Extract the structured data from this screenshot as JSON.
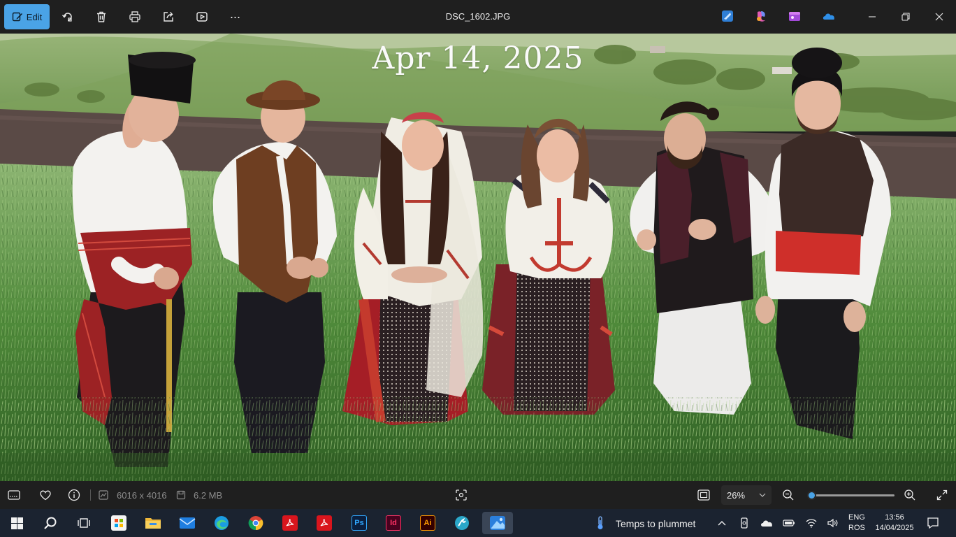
{
  "toolbar": {
    "edit_label": "Edit",
    "buttons": [
      "rotate-icon",
      "delete-icon",
      "print-icon",
      "share-icon",
      "slideshow-icon",
      "more-icon"
    ],
    "more_label": "···"
  },
  "window": {
    "title": "DSC_1602.JPG",
    "apps": [
      "clipchamp-icon",
      "copilot-icon",
      "designer-icon",
      "onedrive-icon"
    ],
    "controls": [
      "minimize-icon",
      "maximize-icon",
      "close-icon"
    ]
  },
  "photo": {
    "date_overlay": "Apr 14, 2025",
    "description_icons": []
  },
  "status": {
    "dimensions": "6016 x 4016",
    "file_size": "6.2 MB",
    "zoom": "26%",
    "zoom_level": 0.26,
    "accent": "#4aa3e6"
  },
  "taskbar": {
    "weather_text": "Temps to plummet",
    "lang_top": "ENG",
    "lang_bottom": "ROS",
    "time": "13:56",
    "date": "14/04/2025",
    "apps": [
      {
        "name": "store",
        "label": ""
      },
      {
        "name": "file-explorer",
        "label": ""
      },
      {
        "name": "mail",
        "label": ""
      },
      {
        "name": "edge",
        "label": ""
      },
      {
        "name": "chrome",
        "label": ""
      },
      {
        "name": "acrobat",
        "label": ""
      },
      {
        "name": "acrobat-reader",
        "label": ""
      },
      {
        "name": "photoshop",
        "label": "Ps"
      },
      {
        "name": "indesign",
        "label": "Id"
      },
      {
        "name": "illustrator",
        "label": "Ai"
      },
      {
        "name": "app-circle",
        "label": ""
      },
      {
        "name": "photos",
        "label": ""
      }
    ]
  }
}
